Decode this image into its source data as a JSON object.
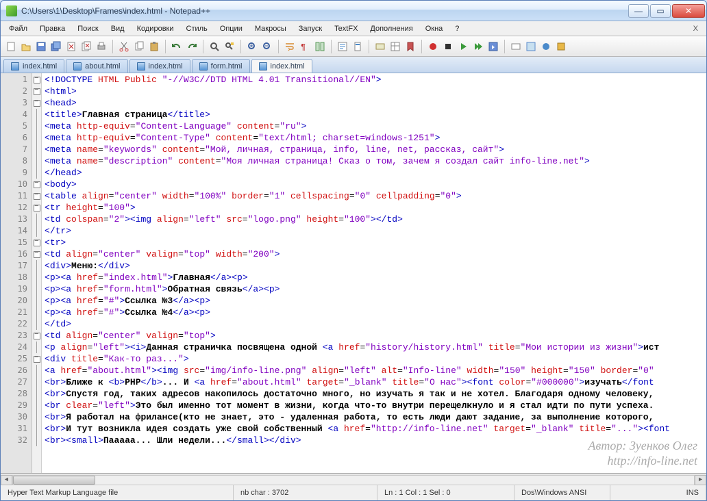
{
  "window": {
    "title": "C:\\Users\\1\\Desktop\\Frames\\index.html - Notepad++"
  },
  "menubar": {
    "items": [
      "Файл",
      "Правка",
      "Поиск",
      "Вид",
      "Кодировки",
      "Стиль",
      "Опции",
      "Макросы",
      "Запуск",
      "TextFX",
      "Дополнения",
      "Окна",
      "?"
    ]
  },
  "tabs": [
    {
      "label": "index.html",
      "active": false
    },
    {
      "label": "about.html",
      "active": false
    },
    {
      "label": "index.html",
      "active": false
    },
    {
      "label": "form.html",
      "active": false
    },
    {
      "label": "index.html",
      "active": true
    }
  ],
  "code_lines": [
    {
      "n": 1,
      "fold": "box",
      "raw": "<!DOCTYPE HTML Public \"-//W3C//DTD HTML 4.01 Transitional//EN\">"
    },
    {
      "n": 2,
      "fold": "box",
      "raw": "<html>"
    },
    {
      "n": 3,
      "fold": "box",
      "raw": "<head>"
    },
    {
      "n": 4,
      "fold": "line",
      "raw": "<title>Главная страница</title>"
    },
    {
      "n": 5,
      "fold": "line",
      "raw": "<meta http-equiv=\"Content-Language\" content=\"ru\">"
    },
    {
      "n": 6,
      "fold": "line",
      "raw": "<meta http-equiv=\"Content-Type\" content=\"text/html; charset=windows-1251\">"
    },
    {
      "n": 7,
      "fold": "line",
      "raw": "<meta name=\"keywords\" content=\"Мой, личная, страница, info, line, net, рассказ, сайт\">"
    },
    {
      "n": 8,
      "fold": "line",
      "raw": "<meta name=\"description\" content=\"Моя личная страница! Сказ о том, зачем я создал сайт info-line.net\">"
    },
    {
      "n": 9,
      "fold": "line",
      "raw": "</head>"
    },
    {
      "n": 10,
      "fold": "box",
      "raw": "<body>"
    },
    {
      "n": 11,
      "fold": "box",
      "raw": "<table align=\"center\" width=\"100%\" border=\"1\" cellspacing=\"0\" cellpadding=\"0\">"
    },
    {
      "n": 12,
      "fold": "box",
      "raw": "<tr height=\"100\">"
    },
    {
      "n": 13,
      "fold": "line",
      "raw": "<td colspan=\"2\"><img align=\"left\" src=\"logo.png\" height=\"100\"></td>"
    },
    {
      "n": 14,
      "fold": "line",
      "raw": "</tr>"
    },
    {
      "n": 15,
      "fold": "box",
      "raw": "<tr>"
    },
    {
      "n": 16,
      "fold": "box",
      "raw": "<td align=\"center\" valign=\"top\" width=\"200\">"
    },
    {
      "n": 17,
      "fold": "line",
      "raw": "<div>Меню:</div>"
    },
    {
      "n": 18,
      "fold": "line",
      "raw": "<p><a href=\"index.html\">Главная</a><p>"
    },
    {
      "n": 19,
      "fold": "line",
      "raw": "<p><a href=\"form.html\">Обратная связь</a><p>"
    },
    {
      "n": 20,
      "fold": "line",
      "raw": "<p><a href=\"#\">Ссылка №3</a><p>"
    },
    {
      "n": 21,
      "fold": "line",
      "raw": "<p><a href=\"#\">Ссылка №4</a><p>"
    },
    {
      "n": 22,
      "fold": "line",
      "raw": "</td>"
    },
    {
      "n": 23,
      "fold": "box",
      "raw": "<td align=\"center\" valign=\"top\">"
    },
    {
      "n": 24,
      "fold": "line",
      "raw": "<p align=\"left\"><i>Данная страничка посвящена одной <a href=\"history/history.html\" title=\"Мои истории из жизни\">ист"
    },
    {
      "n": 25,
      "fold": "box",
      "raw": "<div title=\"Как-то раз...\">"
    },
    {
      "n": 26,
      "fold": "line",
      "raw": "<a href=\"about.html\"><img src=\"img/info-line.png\" align=\"left\" alt=\"Info-line\" width=\"150\" height=\"150\" border=\"0\""
    },
    {
      "n": 27,
      "fold": "line",
      "raw": "<br>Ближе к <b>PHP</b>... И <a href=\"about.html\" target=\"_blank\" title=\"О нас\"><font color=\"#000000\">изучать</font"
    },
    {
      "n": 28,
      "fold": "line",
      "raw": "<br>Спустя год, таких адресов накопилось достаточно много, но изучать я так и не хотел. Благодаря одному человеку,"
    },
    {
      "n": 29,
      "fold": "line",
      "raw": "<br clear=\"left\">Это был именно тот момент в жизни, когда что-то внутри перещелкнуло и я стал идти по пути успеха."
    },
    {
      "n": 30,
      "fold": "line",
      "raw": "<br>Я работал на фрилансе(кто не знает, это - удаленная работа, то есть люди дают задание, за выполнение которого,"
    },
    {
      "n": 31,
      "fold": "line",
      "raw": "<br>И тут возникла идея создать уже свой собственный <a href=\"http://info-line.net\" target=\"_blank\" title=\"...\"><font"
    },
    {
      "n": 32,
      "fold": "line",
      "raw": "<br><small>Пааааа... Шли недели...</small></div>"
    }
  ],
  "statusbar": {
    "file_type": "Hyper Text Markup Language file",
    "nb_char": "nb char : 3702",
    "position": "Ln : 1   Col : 1   Sel : 0",
    "encoding": "Dos\\Windows   ANSI",
    "mode": "INS"
  },
  "watermark": {
    "line1": "Автор: Зуенков Олег",
    "line2": "http://info-line.net"
  }
}
